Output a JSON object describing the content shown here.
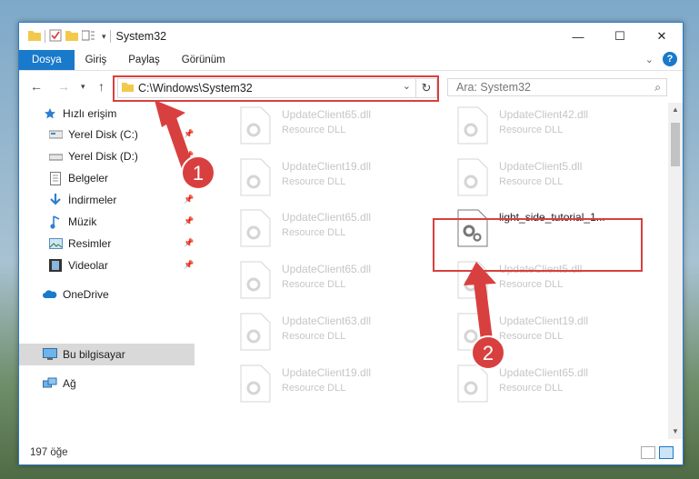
{
  "window": {
    "title": "System32"
  },
  "ribbon": {
    "tabs": [
      {
        "label": "Dosya",
        "active": true
      },
      {
        "label": "Giriş"
      },
      {
        "label": "Paylaş"
      },
      {
        "label": "Görünüm"
      }
    ],
    "help": "?"
  },
  "address": {
    "path": "C:\\Windows\\System32"
  },
  "search": {
    "placeholder": "Ara: System32"
  },
  "nav": {
    "items": [
      {
        "label": "Hızlı erişim",
        "icon": "star-icon"
      },
      {
        "label": "Yerel Disk (C:)",
        "icon": "drive-icon",
        "pinned": true
      },
      {
        "label": "Yerel Disk (D:)",
        "icon": "drive-icon",
        "pinned": true
      },
      {
        "label": "Belgeler",
        "icon": "documents-icon",
        "pinned": true
      },
      {
        "label": "İndirmeler",
        "icon": "download-icon",
        "pinned": true
      },
      {
        "label": "Müzik",
        "icon": "music-icon",
        "pinned": true
      },
      {
        "label": "Resimler",
        "icon": "pictures-icon",
        "pinned": true
      },
      {
        "label": "Videolar",
        "icon": "videos-icon",
        "pinned": true
      },
      {
        "label": "OneDrive",
        "icon": "cloud-icon"
      },
      {
        "label": "Bu bilgisayar",
        "icon": "computer-icon",
        "selected": true
      },
      {
        "label": "Ağ",
        "icon": "network-icon"
      }
    ]
  },
  "files": [
    {
      "name": "UpdateClient65.dll",
      "type": "Resource DLL"
    },
    {
      "name": "UpdateClient42.dll",
      "type": "Resource DLL"
    },
    {
      "name": "UpdateClient19.dll",
      "type": "Resource DLL"
    },
    {
      "name": "UpdateClient5.dll",
      "type": "Resource DLL"
    },
    {
      "name": "UpdateClient65.dll",
      "type": "Resource DLL"
    },
    {
      "name": "light_side_tutorial_1...",
      "type": "",
      "highlighted": true
    },
    {
      "name": "UpdateClient65.dll",
      "type": "Resource DLL"
    },
    {
      "name": "UpdateClient5.dll",
      "type": "Resource DLL"
    },
    {
      "name": "UpdateClient63.dll",
      "type": "Resource DLL"
    },
    {
      "name": "UpdateClient19.dll",
      "type": "Resource DLL"
    },
    {
      "name": "UpdateClient19.dll",
      "type": "Resource DLL"
    },
    {
      "name": "UpdateClient65.dll",
      "type": "Resource DLL"
    }
  ],
  "status": {
    "count": "197 öğe"
  },
  "annotations": [
    {
      "number": "1"
    },
    {
      "number": "2"
    }
  ],
  "colors": {
    "accent": "#1979ca",
    "highlight": "#d8403f"
  }
}
